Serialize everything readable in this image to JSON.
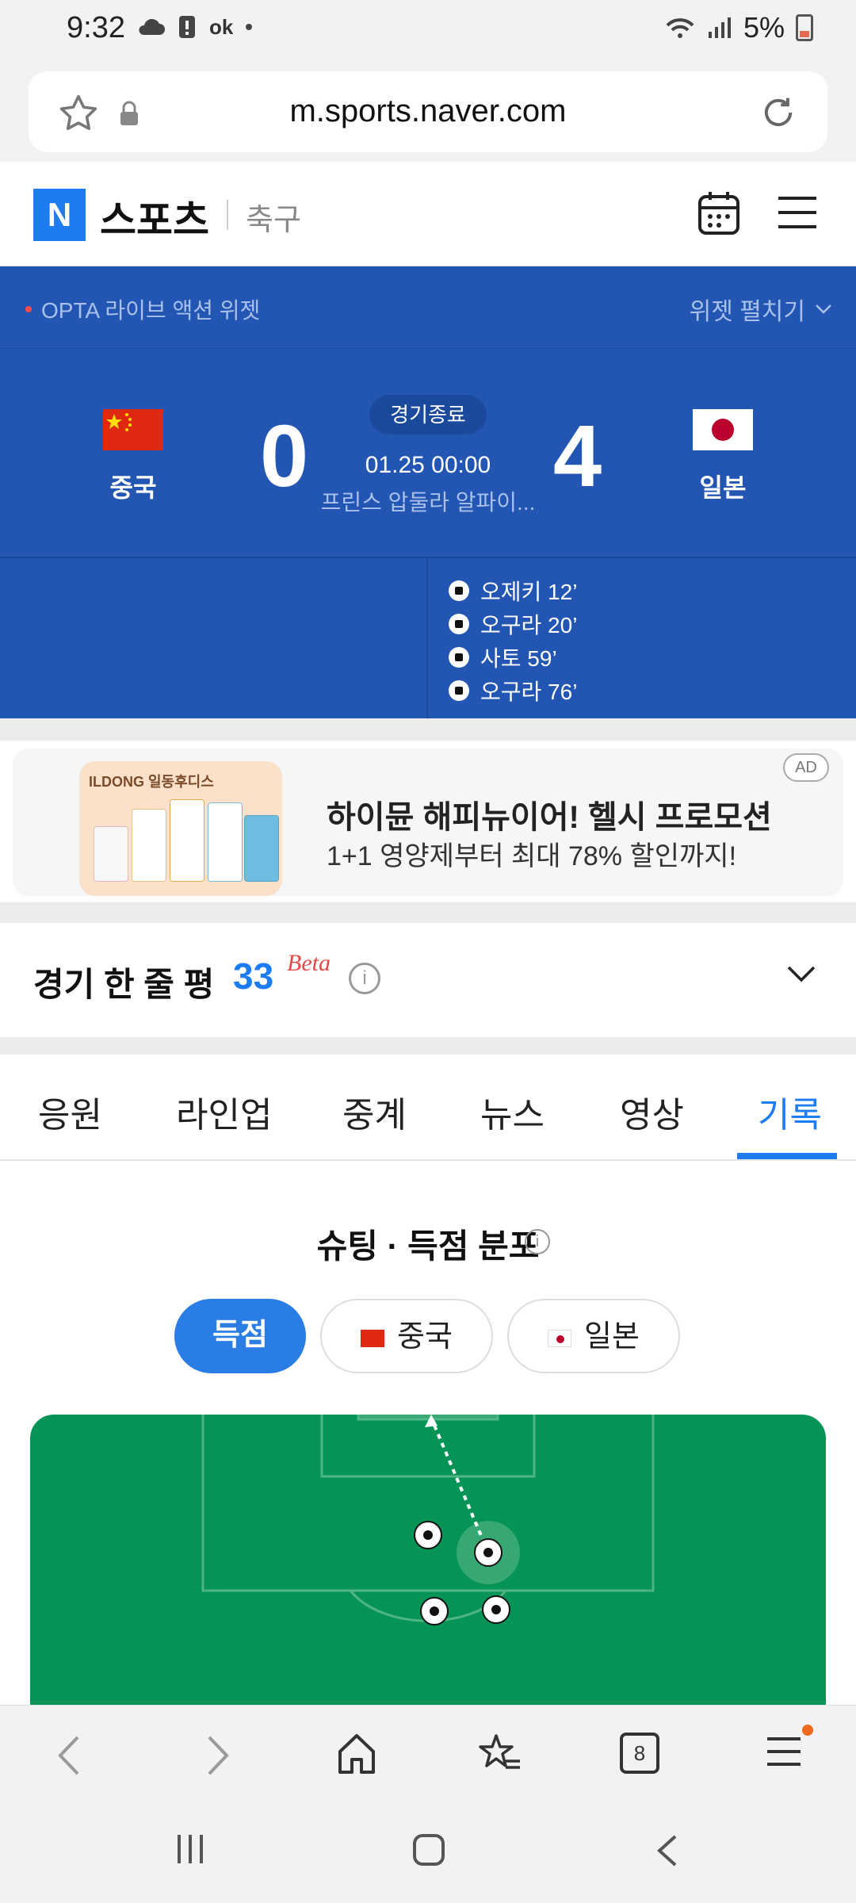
{
  "status_bar": {
    "time": "9:32",
    "left_icons": [
      "cloud-icon",
      "alert-icon",
      "ok-icon",
      "dot-icon"
    ],
    "ok_label": "ok",
    "battery": "5%",
    "battery_color": "#e36b4f"
  },
  "browser": {
    "url": "m.sports.naver.com",
    "tab_count": "8"
  },
  "header": {
    "logo_letter": "N",
    "title": "스포츠",
    "section": "축구",
    "brand_color": "#1e7cf2"
  },
  "widget": {
    "label": "OPTA 라이브 액션 위젯",
    "expand_label": "위젯 펼치기",
    "background": "#2356b3"
  },
  "match": {
    "home": {
      "name": "중국",
      "score": "0",
      "flag": "china-flag"
    },
    "away": {
      "name": "일본",
      "score": "4",
      "flag": "japan-flag"
    },
    "status": "경기종료",
    "datetime": "01.25 00:00",
    "venue": "프린스 압둘라 알파이...",
    "scorers_away": [
      {
        "name": "오제키 12’"
      },
      {
        "name": "오구라 20’"
      },
      {
        "name": "사토 59’"
      },
      {
        "name": "오구라 76’"
      }
    ]
  },
  "ad": {
    "badge": "AD",
    "brand": "ILDONG 일동후디스",
    "title": "하이뮨 해피뉴이어! 헬시 프로모션",
    "subtitle": "1+1 영양제부터 최대 78% 할인까지!"
  },
  "review": {
    "title": "경기 한 줄 평",
    "count": "33",
    "beta": "Beta",
    "info": "i"
  },
  "tabs": [
    {
      "label": "응원",
      "active": false
    },
    {
      "label": "라인업",
      "active": false
    },
    {
      "label": "중계",
      "active": false
    },
    {
      "label": "뉴스",
      "active": false
    },
    {
      "label": "영상",
      "active": false
    },
    {
      "label": "기록",
      "active": true
    }
  ],
  "stats": {
    "title": "슈팅 · 득점 분포",
    "info": "i",
    "filters": {
      "goals": "득점",
      "home": "중국",
      "away": "일본"
    },
    "pitch_color": "#069456",
    "accent": "#2a7de5"
  }
}
